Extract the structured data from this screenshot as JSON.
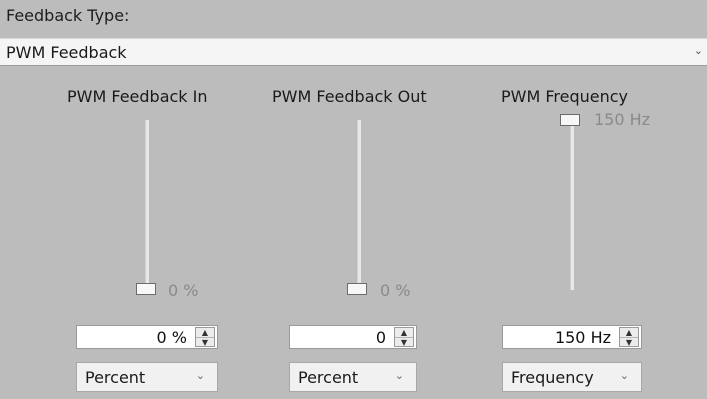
{
  "feedback_type": {
    "label": "Feedback Type:",
    "selected": "PWM Feedback"
  },
  "columns": [
    {
      "title": "PWM Feedback In",
      "slider_value_label": "0 %",
      "slider_fraction": 0,
      "spin_value": "0 %",
      "unit_selected": "Percent"
    },
    {
      "title": "PWM Feedback Out",
      "slider_value_label": "0 %",
      "slider_fraction": 0,
      "spin_value": "0",
      "unit_selected": "Percent"
    },
    {
      "title": "PWM Frequency",
      "slider_value_label": "150 Hz",
      "slider_fraction": 1,
      "spin_value": "150 Hz",
      "unit_selected": "Frequency"
    }
  ],
  "icons": {
    "dropdown": "chevron-down-icon",
    "spin_up": "arrow-up-icon",
    "spin_down": "arrow-down-icon"
  },
  "colors": {
    "panel_background": "#bcbcbc",
    "thumb_label": "#8a8a8a"
  }
}
